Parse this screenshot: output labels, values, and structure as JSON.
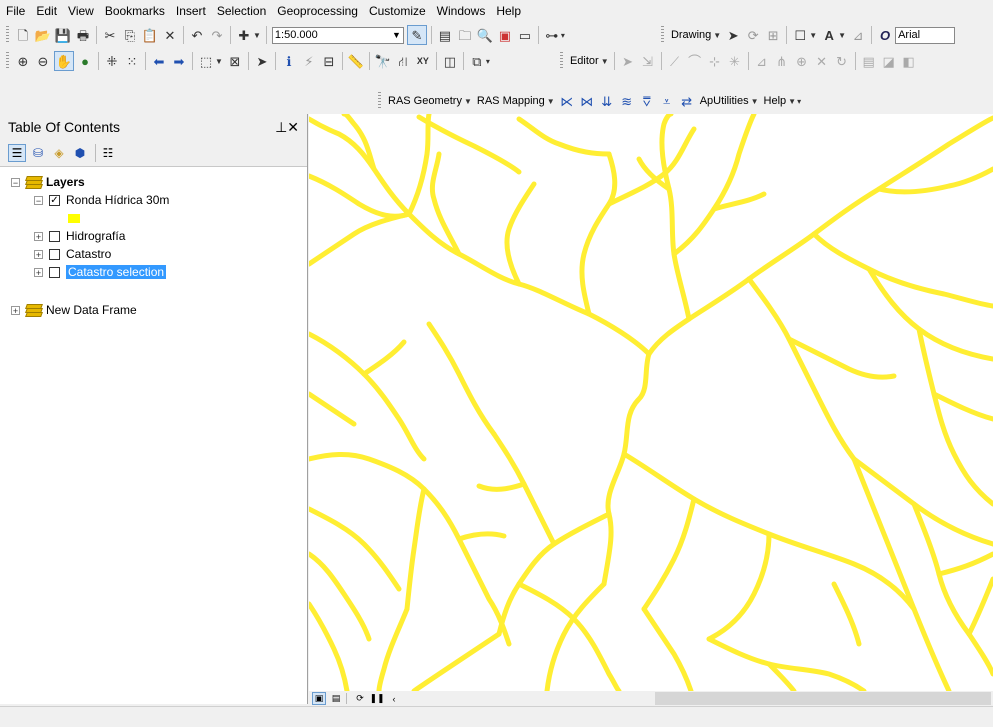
{
  "menu": [
    "File",
    "Edit",
    "View",
    "Bookmarks",
    "Insert",
    "Selection",
    "Geoprocessing",
    "Customize",
    "Windows",
    "Help"
  ],
  "toolbar1": {
    "scale_value": "1:50.000",
    "drawing_label": "Drawing",
    "font_value": "Arial"
  },
  "toolbar2": {
    "editor_label": "Editor"
  },
  "toolbar3": {
    "ras_geometry_label": "RAS Geometry",
    "ras_mapping_label": "RAS Mapping",
    "aputilities_label": "ApUtilities",
    "help_label": "Help"
  },
  "toc": {
    "title": "Table Of Contents",
    "title_controls": "4 ×",
    "layers": {
      "root_label": "Layers",
      "items": [
        {
          "label": "Ronda Hídrica 30m",
          "checked": true,
          "expanded": true,
          "symbol_color": "#ffff00"
        },
        {
          "label": "Hidrografía",
          "checked": false,
          "expanded": false
        },
        {
          "label": "Catastro",
          "checked": false,
          "expanded": false
        },
        {
          "label": "Catastro selection",
          "checked": false,
          "expanded": false,
          "selected": true
        }
      ]
    },
    "second_frame_label": "New Data Frame"
  },
  "map": {
    "stream_color": "#ffee33",
    "background": "#ffffff"
  }
}
